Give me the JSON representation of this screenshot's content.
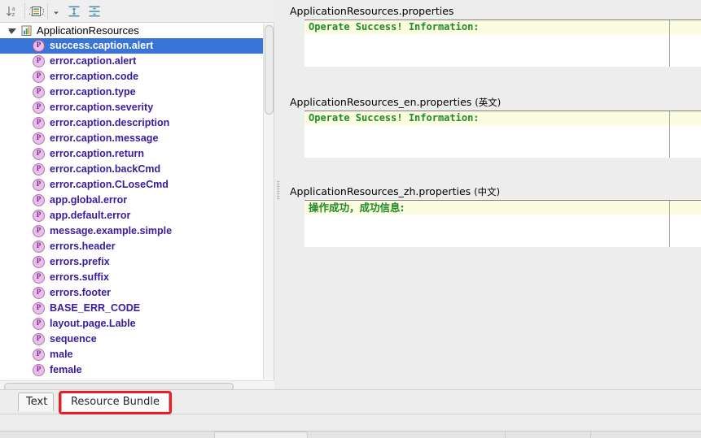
{
  "toolbar": {
    "buttons": [
      {
        "name": "sort-alphabetically-button",
        "icon": "sort-az-icon",
        "tooltip": "Sort alphabetically"
      },
      {
        "name": "group-by-prefix-button",
        "icon": "list-properties-icon",
        "tooltip": "Group by prefix"
      },
      {
        "name": "expand-all-button",
        "icon": "expand-all-icon",
        "tooltip": "Expand All"
      },
      {
        "name": "collapse-all-button",
        "icon": "collapse-all-icon",
        "tooltip": "Collapse All"
      }
    ],
    "dropdown_icon": "chevron-down-icon"
  },
  "tree": {
    "root": {
      "label": "ApplicationResources",
      "icon": "resource-bundle-icon",
      "expanded": true,
      "twisty_icon": "triangle-down-icon"
    },
    "item_icon": "property-key-icon",
    "item_icon_glyph": "P",
    "items": [
      {
        "label": "success.caption.alert",
        "selected": true
      },
      {
        "label": "error.caption.alert",
        "selected": false
      },
      {
        "label": "error.caption.code",
        "selected": false
      },
      {
        "label": "error.caption.type",
        "selected": false
      },
      {
        "label": "error.caption.severity",
        "selected": false
      },
      {
        "label": "error.caption.description",
        "selected": false
      },
      {
        "label": "error.caption.message",
        "selected": false
      },
      {
        "label": "error.caption.return",
        "selected": false
      },
      {
        "label": "error.caption.backCmd",
        "selected": false
      },
      {
        "label": "error.caption.CLoseCmd",
        "selected": false
      },
      {
        "label": "app.global.error",
        "selected": false
      },
      {
        "label": "app.default.error",
        "selected": false
      },
      {
        "label": "message.example.simple",
        "selected": false
      },
      {
        "label": "errors.header",
        "selected": false
      },
      {
        "label": "errors.prefix",
        "selected": false
      },
      {
        "label": "errors.suffix",
        "selected": false
      },
      {
        "label": "errors.footer",
        "selected": false
      },
      {
        "label": "BASE_ERR_CODE",
        "selected": false
      },
      {
        "label": "layout.page.Lable",
        "selected": false
      },
      {
        "label": "sequence",
        "selected": false
      },
      {
        "label": "male",
        "selected": false
      },
      {
        "label": "female",
        "selected": false
      }
    ]
  },
  "locale_groups": [
    {
      "title": "ApplicationResources.properties",
      "lang": "",
      "value": "Operate Success! Information:",
      "cjk": false
    },
    {
      "title": "ApplicationResources_en.properties",
      "lang": "(英文)",
      "value": "Operate Success! Information:",
      "cjk": false
    },
    {
      "title": "ApplicationResources_zh.properties",
      "lang": "(中文)",
      "value": "操作成功，成功信息:",
      "cjk": true
    }
  ],
  "tabs": [
    {
      "label": "Text",
      "active": false
    },
    {
      "label": "Resource Bundle",
      "active": true
    }
  ],
  "colors": {
    "selection_blue": "#3875d7",
    "key_text_purple": "#3a1a9e",
    "value_text_green": "#1f8a27",
    "editor_line_highlight": "#fcfce0",
    "annotation_red": "#ec1c24",
    "panel_bg": "#ededed"
  }
}
